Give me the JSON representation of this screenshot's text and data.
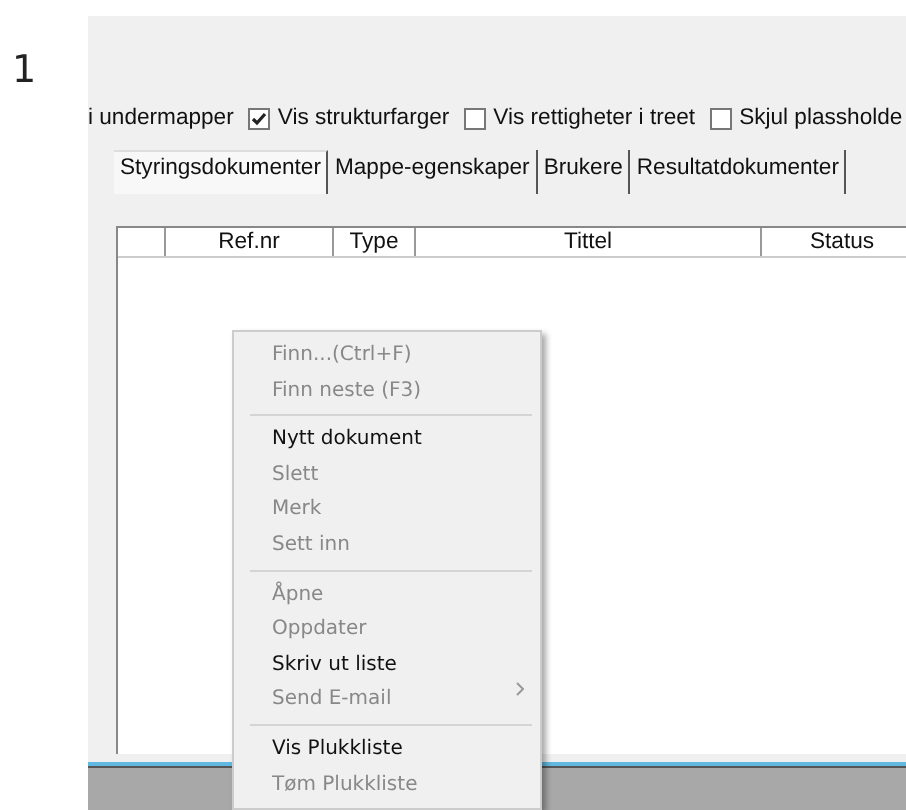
{
  "step_number": "1",
  "options": [
    {
      "label": "i undermapper",
      "kind": "text"
    },
    {
      "label": "Vis strukturfarger",
      "kind": "checkbox",
      "checked": true
    },
    {
      "label": "Vis rettigheter i treet",
      "kind": "checkbox",
      "checked": false
    },
    {
      "label": "Skjul plassholde",
      "kind": "checkbox",
      "checked": false
    }
  ],
  "tabs": [
    {
      "label": "Styringsdokumenter",
      "selected": true
    },
    {
      "label": "Mappe-egenskaper",
      "selected": false
    },
    {
      "label": "Brukere",
      "selected": false
    },
    {
      "label": "Resultatdokumenter",
      "selected": false
    }
  ],
  "table": {
    "columns": [
      "",
      "Ref.nr",
      "Type",
      "Tittel",
      "Status"
    ]
  },
  "context_menu": [
    {
      "label": "Finn...(Ctrl+F)",
      "disabled": true,
      "submenu": false,
      "separator_after": false
    },
    {
      "label": "Finn neste (F3)",
      "disabled": true,
      "submenu": false,
      "separator_after": true
    },
    {
      "label": "Nytt dokument",
      "disabled": false,
      "submenu": false,
      "separator_after": false
    },
    {
      "label": "Slett",
      "disabled": true,
      "submenu": false,
      "separator_after": false
    },
    {
      "label": "Merk",
      "disabled": true,
      "submenu": false,
      "separator_after": false
    },
    {
      "label": "Sett inn",
      "disabled": true,
      "submenu": false,
      "separator_after": true
    },
    {
      "label": "Åpne",
      "disabled": true,
      "submenu": false,
      "separator_after": false
    },
    {
      "label": "Oppdater",
      "disabled": true,
      "submenu": false,
      "separator_after": false
    },
    {
      "label": "Skriv ut liste",
      "disabled": false,
      "submenu": false,
      "separator_after": false
    },
    {
      "label": "Send E-mail",
      "disabled": true,
      "submenu": true,
      "separator_after": true
    },
    {
      "label": "Vis Plukkliste",
      "disabled": false,
      "submenu": false,
      "separator_after": false
    },
    {
      "label": "Tøm Plukkliste",
      "disabled": true,
      "submenu": false,
      "separator_after": false
    }
  ]
}
